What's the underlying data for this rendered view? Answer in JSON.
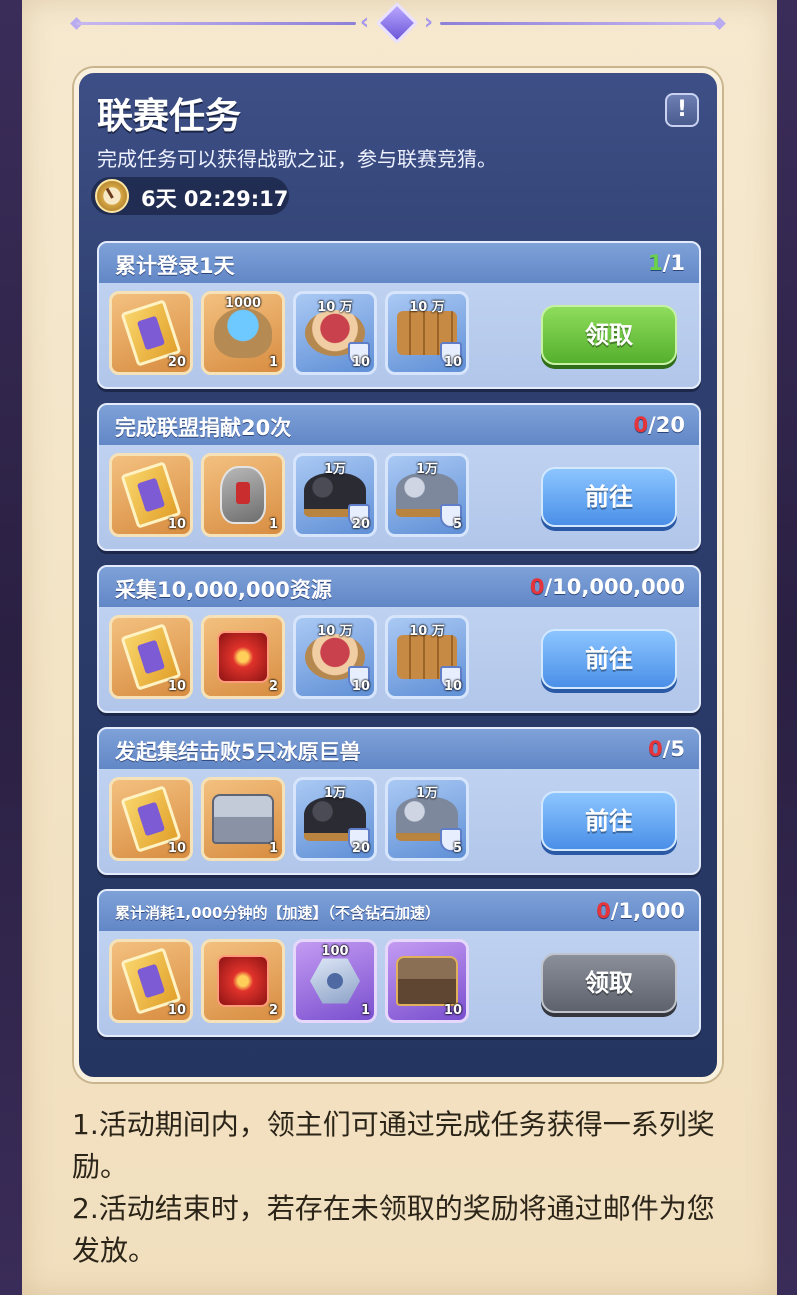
{
  "panel": {
    "title": "联赛任务",
    "description": "完成任务可以获得战歌之证，参与联赛竞猜。",
    "info_glyph": "!",
    "timer": "6天 02:29:17"
  },
  "tasks": [
    {
      "name": "累计登录1天",
      "progress_current": "1",
      "progress_total": "/1",
      "button": "领取",
      "rewards": [
        {
          "icon": "ticket-icon",
          "count": "20",
          "top": ""
        },
        {
          "icon": "sack-icon",
          "count": "1",
          "top": "1000"
        },
        {
          "icon": "meat-icon",
          "count": "10",
          "top": "10 万"
        },
        {
          "icon": "wood-icon",
          "count": "10",
          "top": "10 万"
        }
      ]
    },
    {
      "name": "完成联盟捐献20次",
      "progress_current": "0",
      "progress_total": "/20",
      "button": "前往",
      "rewards": [
        {
          "icon": "ticket-icon",
          "count": "10",
          "top": ""
        },
        {
          "icon": "stone-icon",
          "count": "1",
          "top": ""
        },
        {
          "icon": "coal-icon",
          "count": "20",
          "top": "1万"
        },
        {
          "icon": "iron-icon",
          "count": "5",
          "top": "1万"
        }
      ]
    },
    {
      "name": "采集10,000,000资源",
      "progress_current": "0",
      "progress_total": "/10,000,000",
      "button": "前往",
      "rewards": [
        {
          "icon": "ticket-icon",
          "count": "10",
          "top": ""
        },
        {
          "icon": "cube-icon",
          "count": "2",
          "top": ""
        },
        {
          "icon": "meat-icon",
          "count": "10",
          "top": "10 万"
        },
        {
          "icon": "wood-icon",
          "count": "10",
          "top": "10 万"
        }
      ]
    },
    {
      "name": "发起集结击败5只冰原巨兽",
      "progress_current": "0",
      "progress_total": "/5",
      "button": "前往",
      "rewards": [
        {
          "icon": "ticket-icon",
          "count": "10",
          "top": ""
        },
        {
          "icon": "chest-icon",
          "count": "1",
          "top": ""
        },
        {
          "icon": "coal-icon",
          "count": "20",
          "top": "1万"
        },
        {
          "icon": "iron-icon",
          "count": "5",
          "top": "1万"
        }
      ]
    },
    {
      "name": "累计消耗1,000分钟的【加速】（不含钻石加速）",
      "progress_current": "0",
      "progress_total": "/1,000",
      "button": "领取",
      "rewards": [
        {
          "icon": "ticket-icon",
          "count": "10",
          "top": ""
        },
        {
          "icon": "cube-icon",
          "count": "2",
          "top": ""
        },
        {
          "icon": "bolt-icon",
          "count": "1",
          "top": "100"
        },
        {
          "icon": "gold-chest-icon",
          "count": "10",
          "top": ""
        }
      ]
    }
  ],
  "notes": [
    "1.活动期间内，领主们可通过完成任务获得一系列奖励。",
    "2.活动结束时，若存在未领取的奖励将通过邮件为您发放。"
  ],
  "colors": {
    "panel_bg": "#2e3e6e",
    "parchment": "#f3e4c6",
    "claim_green": "#55b02e",
    "goto_blue": "#4a8fe8",
    "disabled_gray": "#5d626c",
    "progress_red": "#e5353a",
    "progress_done": "#6bd24b"
  }
}
